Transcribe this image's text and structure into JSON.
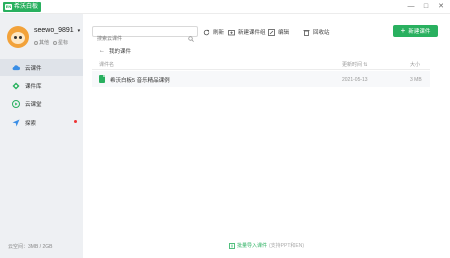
{
  "titlebar": {
    "app_name": "希沃白板",
    "logo_text": "EN",
    "minimize": "—",
    "maximize": "□",
    "close": "✕"
  },
  "user": {
    "name": "seewo_9891",
    "meta": [
      "其他",
      "星标"
    ]
  },
  "sidebar": {
    "items": [
      {
        "label": "云课件",
        "icon": "cloud-icon"
      },
      {
        "label": "课件库",
        "icon": "book-icon"
      },
      {
        "label": "云课堂",
        "icon": "play-circle-icon"
      },
      {
        "label": "探索",
        "icon": "compass-icon"
      }
    ],
    "active_index": 0,
    "storage": "云空间：3MB / 2GB"
  },
  "toolbar": {
    "search_placeholder": "搜索云课件",
    "refresh": "刷新",
    "new_group": "新建课件组",
    "edit": "编辑",
    "recycle": "回收站",
    "new_courseware": "新建课件"
  },
  "breadcrumb": {
    "back": "←",
    "current": "我的课件"
  },
  "table": {
    "columns": [
      "课件名",
      "更新时间",
      "大小"
    ],
    "rows": [
      {
        "name": "希沃白板5 音乐精品课例",
        "updated": "2021-05-13",
        "size": "3 MB"
      }
    ]
  },
  "footer": {
    "batch_import": "批量导入课件",
    "batch_hint": "(支持PPT和EN)"
  },
  "colors": {
    "accent": "#29b05f",
    "sidebar_bg": "#eef0f3",
    "alert": "#e33333"
  }
}
